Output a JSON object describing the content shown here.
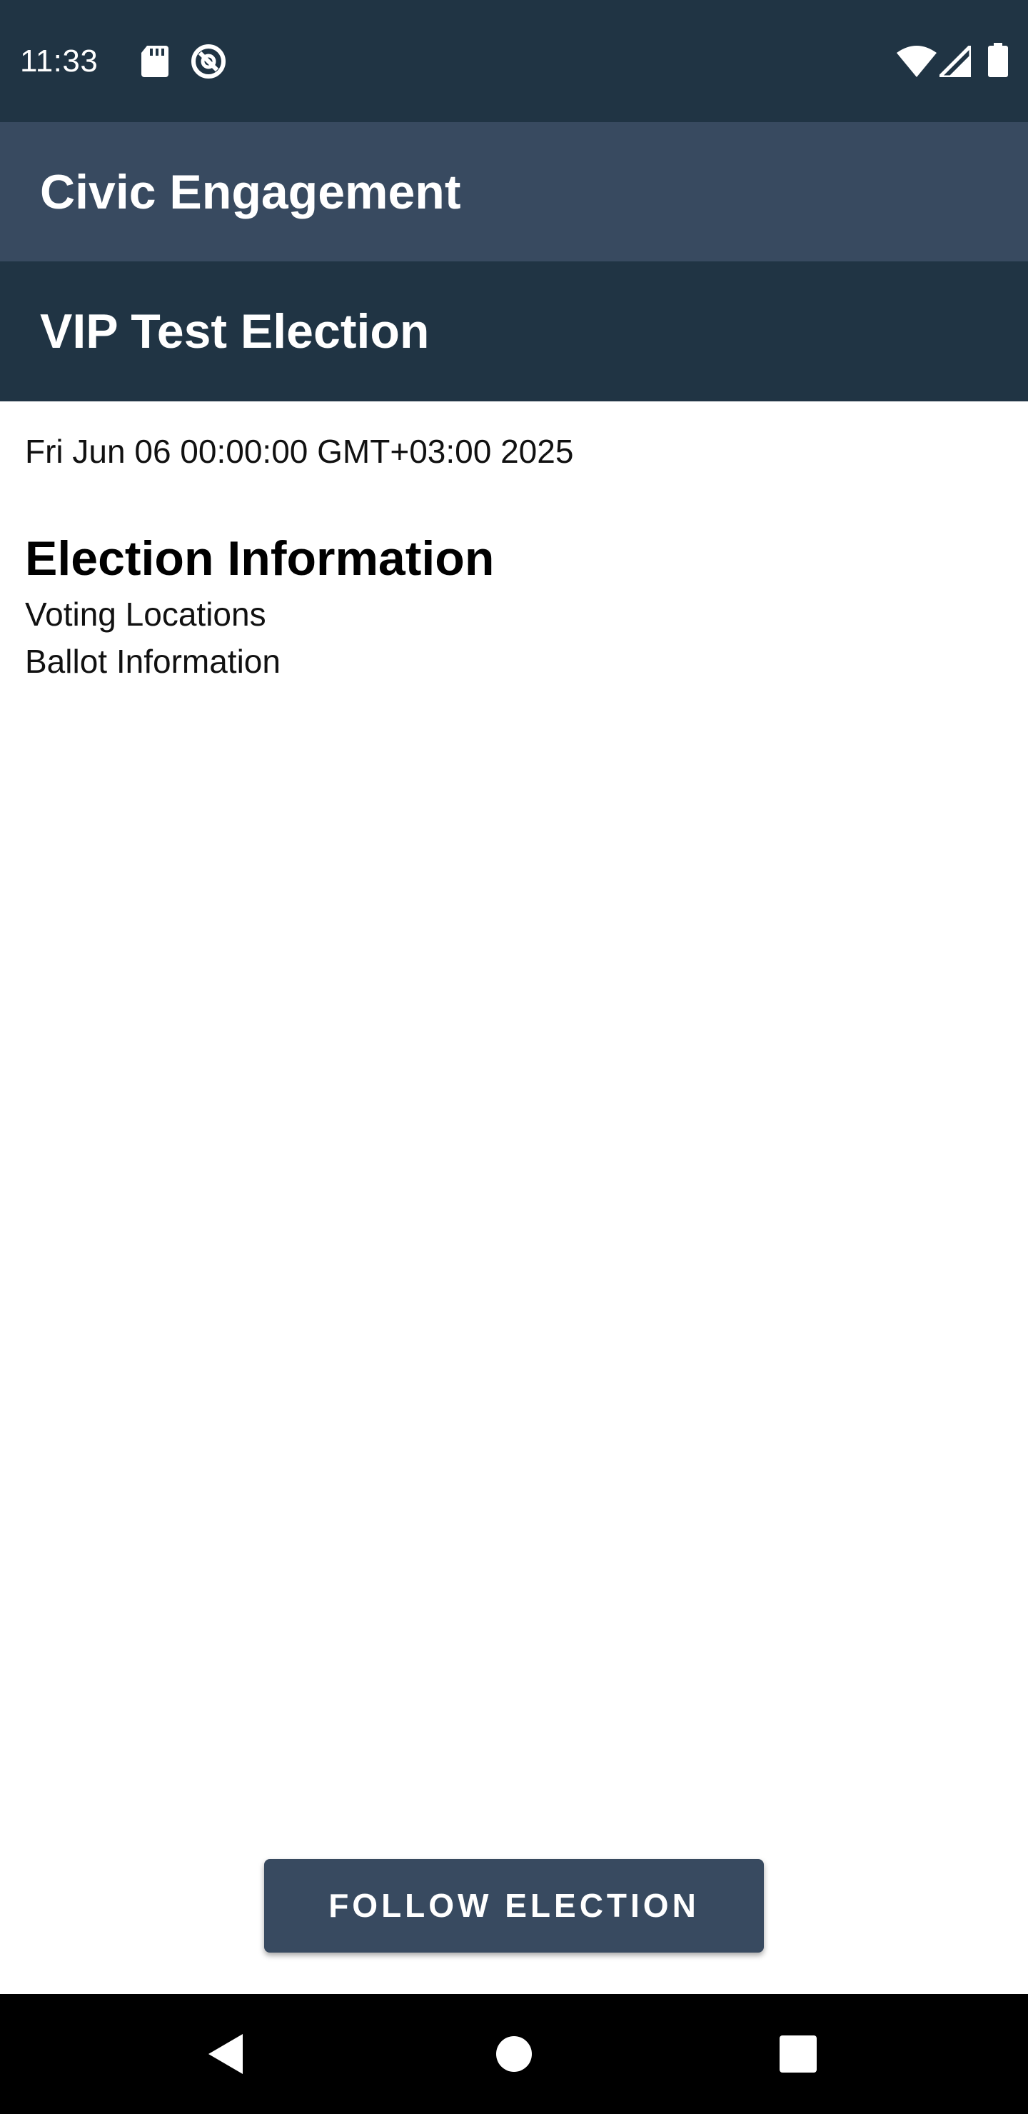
{
  "status_bar": {
    "time": "11:33",
    "left_icons": [
      "sd-card-icon",
      "data-saver-icon"
    ],
    "right_icons": [
      "wifi-icon",
      "signal-icon",
      "battery-icon"
    ]
  },
  "app_bar": {
    "title": "Civic Engagement"
  },
  "election": {
    "name": "VIP Test Election",
    "date": "Fri Jun 06 00:00:00 GMT+03:00 2025"
  },
  "info_section": {
    "heading": "Election Information",
    "links": [
      "Voting Locations",
      "Ballot Information"
    ]
  },
  "actions": {
    "follow_label": "FOLLOW ELECTION"
  },
  "nav_bar": {
    "buttons": [
      "back-icon",
      "home-icon",
      "recents-icon"
    ]
  },
  "colors": {
    "status_bar": "#203444",
    "app_bar": "#384a60",
    "election_bar": "#203444",
    "button": "#384a60"
  }
}
